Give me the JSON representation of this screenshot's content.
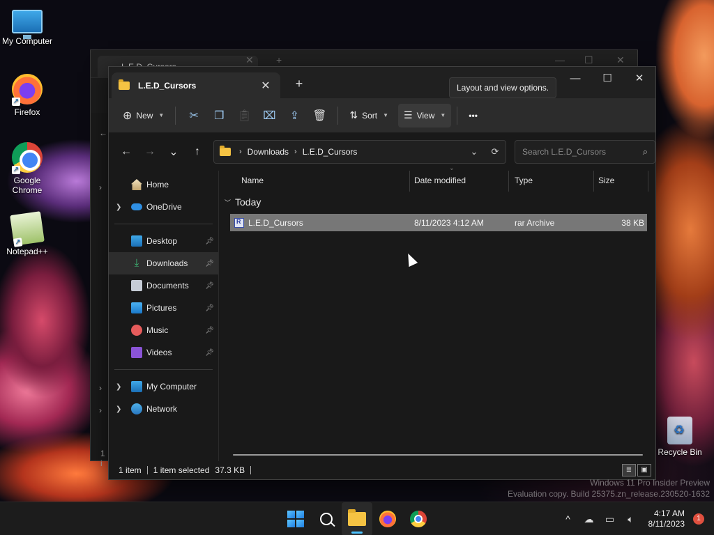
{
  "desktop": {
    "icons": [
      {
        "label": "My Computer",
        "icon": "monitor-icon"
      },
      {
        "label": "Firefox",
        "icon": "firefox-icon"
      },
      {
        "label": "Google Chrome",
        "icon": "chrome-icon"
      },
      {
        "label": "Notepad++",
        "icon": "notepadpp-icon"
      },
      {
        "label": "Recycle Bin",
        "icon": "recycle-bin-icon"
      }
    ],
    "watermark_line1": "Windows 11 Pro Insider Preview",
    "watermark_line2": "Evaluation copy. Build 25375.zn_release.230520-1632"
  },
  "background_window": {
    "tab_title": "L.E.D_Cursors",
    "status_fragment": "1 i"
  },
  "window": {
    "tab_title": "L.E.D_Cursors",
    "tab_close": "✕",
    "new_tab": "+",
    "controls": {
      "minimize": "—",
      "maximize": "☐",
      "close": "✕"
    }
  },
  "toolbar": {
    "new_label": "New",
    "sort_label": "Sort",
    "view_label": "View",
    "more_label": "•••",
    "tooltip": "Layout and view options.",
    "icons": [
      "cut-icon",
      "copy-icon",
      "paste-icon",
      "rename-icon",
      "share-icon",
      "delete-icon"
    ]
  },
  "addressbar": {
    "back": "←",
    "forward": "→",
    "recent": "⌄",
    "up": "↑",
    "crumbs": [
      "Downloads",
      "L.E.D_Cursors"
    ],
    "crumb_sep": "›",
    "refresh": "⟳",
    "dropdown": "⌄",
    "search_placeholder": "Search L.E.D_Cursors"
  },
  "navpane": {
    "top": [
      {
        "label": "Home",
        "expand": "",
        "icon": "home-icon"
      },
      {
        "label": "OneDrive",
        "expand": "›",
        "icon": "onedrive-icon"
      }
    ],
    "quick": [
      {
        "label": "Desktop",
        "icon": "desktop-icon"
      },
      {
        "label": "Downloads",
        "icon": "downloads-icon"
      },
      {
        "label": "Documents",
        "icon": "documents-icon"
      },
      {
        "label": "Pictures",
        "icon": "pictures-icon"
      },
      {
        "label": "Music",
        "icon": "music-icon"
      },
      {
        "label": "Videos",
        "icon": "videos-icon"
      }
    ],
    "bottom": [
      {
        "label": "My Computer",
        "icon": "mycomputer-icon"
      },
      {
        "label": "Network",
        "icon": "network-icon"
      }
    ],
    "selected": "Downloads"
  },
  "content": {
    "columns": [
      "Name",
      "Date modified",
      "Type",
      "Size"
    ],
    "group_label": "Today",
    "files": [
      {
        "name": "L.E.D_Cursors",
        "date": "8/11/2023 4:12 AM",
        "type": "rar Archive",
        "size": "38 KB"
      }
    ]
  },
  "statusbar": {
    "count": "1 item",
    "selected": "1 item selected",
    "size": "37.3 KB"
  },
  "taskbar": {
    "apps": [
      "start-icon",
      "search-icon",
      "file-explorer-icon",
      "firefox-icon",
      "chrome-icon"
    ],
    "tray_chevron": "^",
    "time": "4:17 AM",
    "date": "8/11/2023",
    "notifications": "1"
  },
  "colors": {
    "accent": "#4cc2ff",
    "window_bg": "#191919",
    "toolbar_bg": "#2c2c2c",
    "selected_row": "#777777",
    "folder": "#f6c343"
  }
}
